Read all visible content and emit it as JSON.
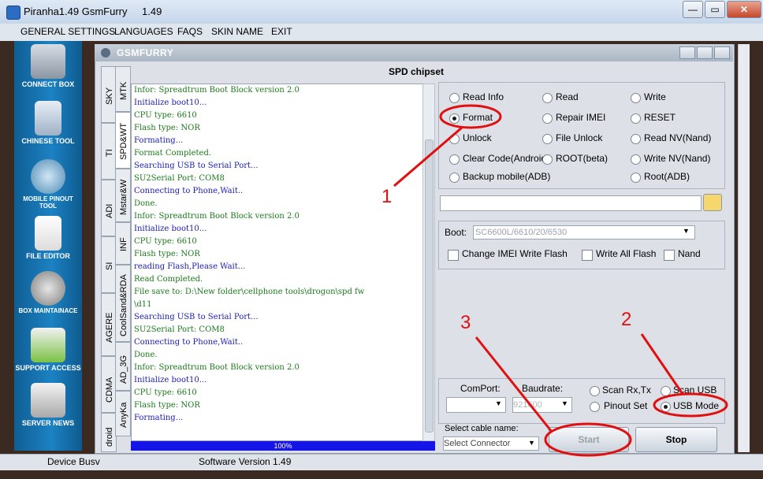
{
  "window": {
    "title": "Piranha1.49 GsmFurry",
    "version": "1.49",
    "min": "▭",
    "max": "▭",
    "close": "✕"
  },
  "menu": [
    "GENERAL SETTINGS",
    "LANGUAGES",
    "FAQS",
    "SKIN NAME",
    "EXIT"
  ],
  "sidebar": [
    {
      "label": "CONNECT BOX",
      "icon": "usb-connector-icon"
    },
    {
      "label": "CHINESE TOOL",
      "icon": "phone-icon"
    },
    {
      "label": "MOBILE PINOUT TOOL",
      "icon": "magnifier-icon"
    },
    {
      "label": "FILE EDITOR",
      "icon": "file-editor-icon"
    },
    {
      "label": "BOX MAINTAINACE",
      "icon": "gears-icon"
    },
    {
      "label": "SUPPORT ACCESS",
      "icon": "support-icon"
    },
    {
      "label": "SERVER NEWS",
      "icon": "newspaper-icon"
    }
  ],
  "inner": {
    "title": "GSMFURRY",
    "chipset_title": "SPD chipset"
  },
  "tabs_outer": [
    "SKY",
    "TI",
    "ADI",
    "SI",
    "AGERE",
    "CDMA",
    "droid"
  ],
  "tabs_inner": [
    "MTK",
    "SPD&WT",
    "Mstar&W",
    "INF",
    "CoolSand&RDA",
    "AD_3G",
    "AnyKa"
  ],
  "log": [
    {
      "text": "Infor: Spreadtrum Boot Block version 2.0",
      "color": "#1a7a1a"
    },
    {
      "text": "Initialize boot10...",
      "color": "#1a1ab8"
    },
    {
      "text": "CPU    type: 6610",
      "color": "#1a7a1a"
    },
    {
      "text": "Flash  type: NOR",
      "color": "#1a7a1a"
    },
    {
      "text": "Formating...",
      "color": "#1a1ab8"
    },
    {
      "text": "Format Completed.",
      "color": "#1a7a1a"
    },
    {
      "text": "Searching USB to Serial Port...",
      "color": "#1a1ab8"
    },
    {
      "text": "SU2Serial Port: COM8",
      "color": "#1a7a1a"
    },
    {
      "text": "Connecting to Phone,Wait..",
      "color": "#1a1ab8"
    },
    {
      "text": "Done.",
      "color": "#1a7a1a"
    },
    {
      "text": "Infor: Spreadtrum Boot Block version 2.0",
      "color": "#1a7a1a"
    },
    {
      "text": "Initialize boot10...",
      "color": "#1a1ab8"
    },
    {
      "text": "CPU    type: 6610",
      "color": "#1a7a1a"
    },
    {
      "text": "Flash  type: NOR",
      "color": "#1a7a1a"
    },
    {
      "text": "reading Flash,Please Wait...",
      "color": "#1a1ab8"
    },
    {
      "text": "Read Completed.",
      "color": "#1a7a1a"
    },
    {
      "text": "File save to: D:\\New folder\\cellphone tools\\drogon\\spd fw",
      "color": "#1a7a1a"
    },
    {
      "text": "\\d11",
      "color": "#1a7a1a"
    },
    {
      "text": "Searching USB to Serial Port...",
      "color": "#1a1ab8"
    },
    {
      "text": "SU2Serial Port: COM8",
      "color": "#1a7a1a"
    },
    {
      "text": "Connecting to Phone,Wait..",
      "color": "#1a1ab8"
    },
    {
      "text": "Done.",
      "color": "#1a7a1a"
    },
    {
      "text": "Infor: Spreadtrum Boot Block version 2.0",
      "color": "#1a7a1a"
    },
    {
      "text": "Initialize boot10...",
      "color": "#1a1ab8"
    },
    {
      "text": "CPU    type: 6610",
      "color": "#1a7a1a"
    },
    {
      "text": "Flash  type: NOR",
      "color": "#1a7a1a"
    },
    {
      "text": "Formating...",
      "color": "#1a1ab8"
    }
  ],
  "progress": {
    "text": "100%",
    "value": 1.0
  },
  "options": [
    [
      "Read Info",
      "Read",
      "Write"
    ],
    [
      "Format",
      "Repair IMEI",
      "RESET"
    ],
    [
      "Unlock",
      "File Unlock",
      "Read NV(Nand)"
    ],
    [
      "Clear Code(Android)",
      "ROOT(beta)",
      "Write NV(Nand)"
    ],
    [
      "Backup mobile(ADB)",
      "",
      "Root(ADB)"
    ]
  ],
  "selected_option": "Format",
  "boot": {
    "label": "Boot:",
    "value": "SC6600L/6610/20/6530"
  },
  "checks": [
    "Change IMEI Write Flash",
    "Write All Flash",
    "Nand"
  ],
  "port": {
    "com_label": "ComPort:",
    "baud_label": "Baudrate:",
    "baud_value": "921600"
  },
  "modes": [
    "Scan Rx,Tx",
    "Scan USB",
    "Pinout Set",
    "USB Mode"
  ],
  "selected_mode": "USB Mode",
  "cable": {
    "label": "Select cable name:",
    "value": "Select Connector"
  },
  "buttons": {
    "start": "Start",
    "stop": "Stop",
    "browse_icon": "folder-open-icon"
  },
  "status": {
    "left": "Device Busv",
    "middle": "Software Version 1.49"
  },
  "annotations": [
    "1",
    "2",
    "3"
  ],
  "colors": {
    "annotation": "#e01010",
    "progress": "#1515e8",
    "sidebar": "#1c82c3"
  }
}
